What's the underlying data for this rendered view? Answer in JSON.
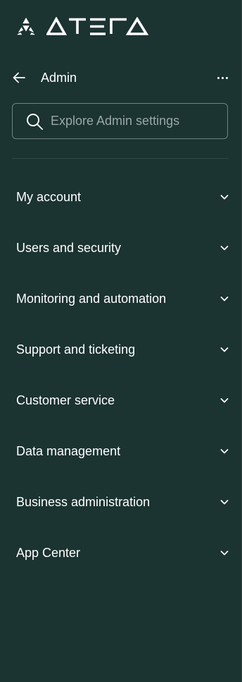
{
  "brand": {
    "wordmark": "ATERA",
    "mark_icon": "atera-logo-icon"
  },
  "header": {
    "title": "Admin",
    "back_icon": "arrow-left-icon",
    "more_icon": "more-horizontal-icon"
  },
  "search": {
    "placeholder": "Explore Admin settings",
    "value": "",
    "icon": "search-icon"
  },
  "nav": {
    "items": [
      {
        "label": "My account",
        "icon": "chevron-down-icon"
      },
      {
        "label": "Users and security",
        "icon": "chevron-down-icon"
      },
      {
        "label": "Monitoring and automation",
        "icon": "chevron-down-icon"
      },
      {
        "label": "Support and ticketing",
        "icon": "chevron-down-icon"
      },
      {
        "label": "Customer service",
        "icon": "chevron-down-icon"
      },
      {
        "label": "Data management",
        "icon": "chevron-down-icon"
      },
      {
        "label": "Business administration",
        "icon": "chevron-down-icon"
      },
      {
        "label": "App Center",
        "icon": "chevron-down-icon"
      }
    ]
  },
  "colors": {
    "background": "#1b3331",
    "text": "#ffffff",
    "placeholder": "#9aa8a6",
    "border": "#6f8380"
  }
}
